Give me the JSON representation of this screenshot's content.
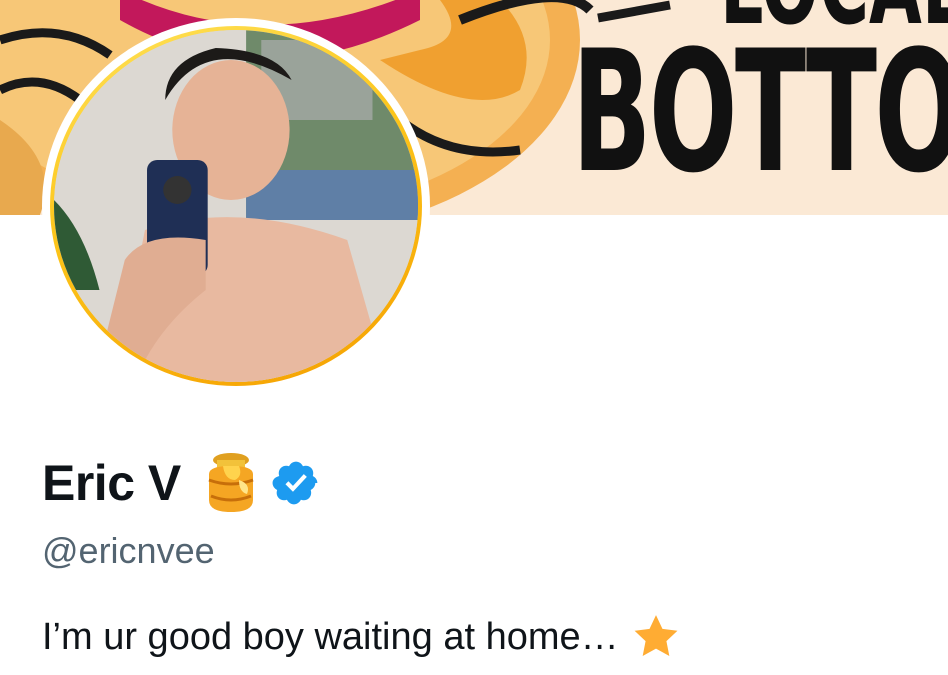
{
  "banner": {
    "text_top": "LOCAL",
    "text_main": "BOTTOM",
    "colors": {
      "background": "#fbe9d5",
      "accent_red": "#c2185b",
      "accent_orange": "#f0a030"
    }
  },
  "profile": {
    "avatar_icon": "avatar-photo",
    "display_name": "Eric V",
    "name_emoji_icon": "honey-pot-icon",
    "verified_icon": "verified-badge-icon",
    "handle": "@ericnvee",
    "bio": "I’m ur good boy waiting at home…",
    "bio_emoji_icon": "star-icon"
  },
  "colors": {
    "text_primary": "#0f1419",
    "text_secondary": "#536471",
    "verified_blue": "#1d9bf0",
    "avatar_ring_gold": "#fcc419"
  }
}
